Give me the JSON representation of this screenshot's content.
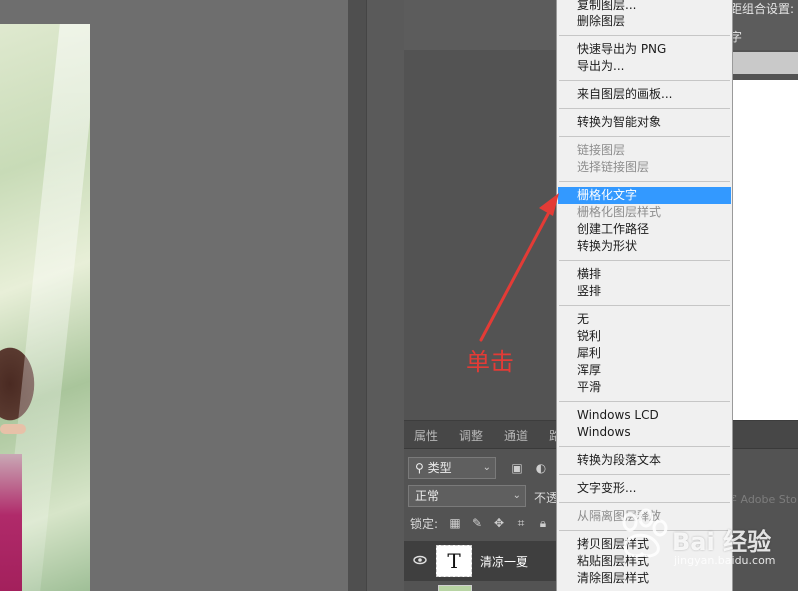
{
  "options_bar": {
    "text_line1": "距组合设置:",
    "text_line2": "字"
  },
  "layers_panel": {
    "tabs": [
      {
        "label": "属性"
      },
      {
        "label": "调整"
      },
      {
        "label": "通道"
      },
      {
        "label": "路"
      }
    ],
    "filter_kind": "类型",
    "blend_mode": "正常",
    "opacity_label": "不透",
    "lock_label": "锁定:",
    "layer": {
      "name": "清凉一夏",
      "thumb_glyph": "T"
    },
    "faint_text": "字 Adobe Sto"
  },
  "context_menu": {
    "items": [
      {
        "label": "复制图层...",
        "disabled": false
      },
      {
        "label": "删除图层",
        "disabled": false
      },
      {
        "label": "快速导出为 PNG",
        "disabled": false
      },
      {
        "label": "导出为...",
        "disabled": false
      },
      {
        "label": "来自图层的画板...",
        "disabled": false
      },
      {
        "label": "转换为智能对象",
        "disabled": false
      },
      {
        "label": "链接图层",
        "disabled": true
      },
      {
        "label": "选择链接图层",
        "disabled": true
      },
      {
        "label": "栅格化文字",
        "disabled": false,
        "highlighted": true
      },
      {
        "label": "栅格化图层样式",
        "disabled": true
      },
      {
        "label": "创建工作路径",
        "disabled": false
      },
      {
        "label": "转换为形状",
        "disabled": false
      },
      {
        "label": "横排",
        "disabled": false
      },
      {
        "label": "竖排",
        "disabled": false
      },
      {
        "label": "无",
        "disabled": false
      },
      {
        "label": "锐利",
        "disabled": false
      },
      {
        "label": "犀利",
        "disabled": false
      },
      {
        "label": "浑厚",
        "disabled": false
      },
      {
        "label": "平滑",
        "disabled": false
      },
      {
        "label": "Windows LCD",
        "disabled": false
      },
      {
        "label": "Windows",
        "disabled": false
      },
      {
        "label": "转换为段落文本",
        "disabled": false
      },
      {
        "label": "文字变形...",
        "disabled": false
      },
      {
        "label": "从隔离图层释放",
        "disabled": true
      },
      {
        "label": "拷贝图层样式",
        "disabled": false
      },
      {
        "label": "粘贴图层样式",
        "disabled": false
      },
      {
        "label": "清除图层样式",
        "disabled": false
      }
    ],
    "highlight_color": "#3399ff"
  },
  "annotation": {
    "text": "单击",
    "color": "#e33b36"
  },
  "watermark": {
    "main": "Bai 经验",
    "url": "jingyan.baidu.com"
  }
}
